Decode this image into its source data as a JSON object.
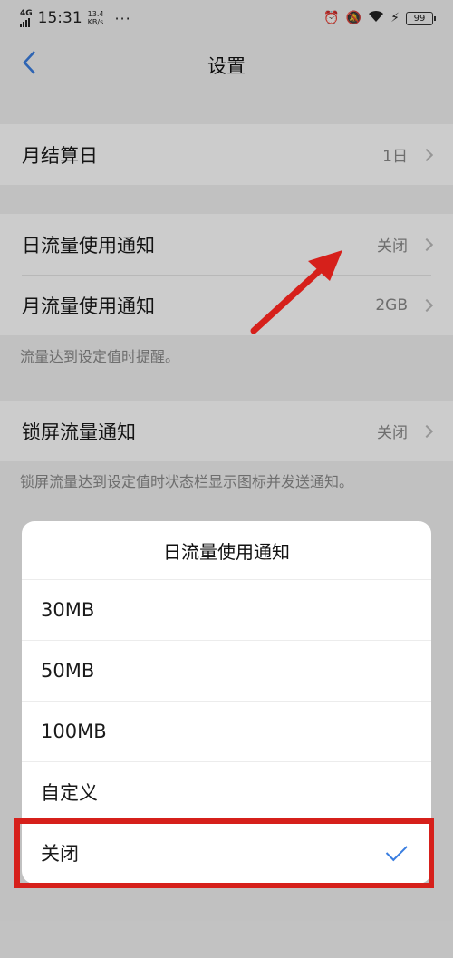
{
  "status_bar": {
    "network": "4G",
    "network_sup": "HD",
    "time": "15:31",
    "speed_value": "13.4",
    "speed_unit": "KB/s",
    "more": "···",
    "battery": "99"
  },
  "nav": {
    "back_icon": "chevron-left-icon",
    "title": "设置"
  },
  "sections": {
    "billing_day": {
      "label": "月结算日",
      "value": "1日"
    },
    "daily_notice": {
      "label": "日流量使用通知",
      "value": "关闭"
    },
    "monthly_notice": {
      "label": "月流量使用通知",
      "value": "2GB"
    },
    "hint_1": "流量达到设定值时提醒。",
    "lockscreen_notice": {
      "label": "锁屏流量通知",
      "value": "关闭"
    },
    "hint_2": "锁屏流量达到设定值时状态栏显示图标并发送通知。"
  },
  "sheet": {
    "title": "日流量使用通知",
    "options": [
      "30MB",
      "50MB",
      "100MB",
      "自定义",
      "关闭"
    ],
    "selected_index": 4
  },
  "colors": {
    "accent": "#3a7ee0",
    "annotation": "#d6201b"
  }
}
